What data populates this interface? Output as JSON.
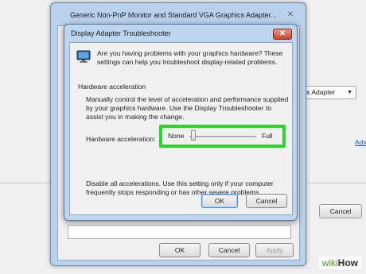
{
  "background_window": {
    "adapter_combo": "cs Adapter",
    "link_text": "Adv",
    "cancel_label": "Cancel"
  },
  "monitor_window": {
    "title": "Generic Non-PnP Monitor and Standard VGA Graphics Adapter...",
    "close_glyph": "✕",
    "ok_label": "OK",
    "cancel_label": "Cancel",
    "apply_label": "Apply"
  },
  "dialog": {
    "title": "Display Adapter Troubleshooter",
    "close_glyph": "✕",
    "intro": "Are you having problems with your graphics hardware? These settings can help you troubleshoot display-related problems.",
    "group_title": "Hardware acceleration",
    "group_desc": "Manually control the level of acceleration and performance supplied by your graphics hardware. Use the Display Troubleshooter to assist you in making the change.",
    "hw_label": "Hardware acceleration:",
    "slider": {
      "min_label": "None",
      "max_label": "Full",
      "level": 0
    },
    "status_desc": "Disable all accelerations. Use this setting only if your computer frequently stops responding or has other severe problems.",
    "ok_label": "OK",
    "cancel_label": "Cancel"
  },
  "watermark": {
    "wiki": "wiki",
    "how": "How"
  },
  "colors": {
    "highlight": "#2cd32c",
    "title_bar": "#bdd5ee",
    "close_button": "#c5452c"
  }
}
